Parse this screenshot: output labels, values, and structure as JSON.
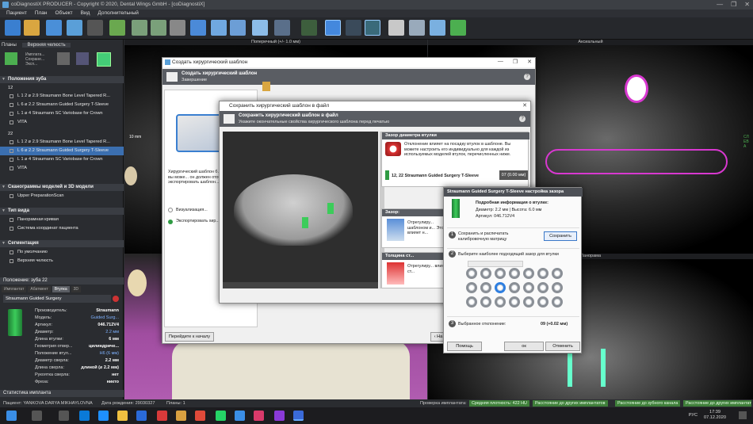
{
  "window": {
    "title": "coDiagnostiX PRODUCER - Copyright © 2020, Dental Wings GmbH - [coDiagnostiX]",
    "controls": [
      "—",
      "❐",
      "✕"
    ]
  },
  "menu": [
    "Пациент",
    "План",
    "Объект",
    "Вид",
    "Дополнительный"
  ],
  "left_panel": {
    "plans_label": "Планы",
    "jaw_label": "Верхняя челюсть",
    "toolbar_texts": [
      "Имплата...",
      "Сохране...",
      "Эксп..."
    ],
    "implants_section": "Положения зуба",
    "group1_label": "12",
    "group1_items": [
      "L 1 2 ⌀ 2.9  Straumann Bone Level Tapered R...",
      "L 6 ⌀ 2.2  Straumann Guided Surgery T-Sleeve",
      "L 1 ⌀ 4  Straumann SC Variobase for Crown",
      "VITA"
    ],
    "group2_label": "22",
    "group2_items": [
      "L 1 2 ⌀ 2.9  Straumann Bone Level Tapered R...",
      "L 6 ⌀ 2.2  Straumann Guided Surgery T-Sleeve",
      "L 1 ⌀ 4  Straumann SC Variobase for Crown",
      "VITA"
    ],
    "models_section": "Сканограммы моделей и 3D модели",
    "models_item": "Upper PreparationScan",
    "view_section": "Тип вида",
    "view_items": [
      "Панорамная кривая",
      "Система координат пациента"
    ],
    "segm_section": "Сегментация",
    "segm_items": [
      "По умолчанию",
      "Верхняя челюсть"
    ],
    "position_label": "Положение: зуба 22",
    "props_tabs": [
      "Имплантат",
      "Абатмент",
      "Втулка",
      "3D"
    ],
    "sleeve_name": "Straumann Guided Surgery",
    "props": [
      {
        "k": "Производитель:",
        "v": "Straumann",
        "blue": false
      },
      {
        "k": "Модель:",
        "v": "Guided Surg...",
        "blue": true
      },
      {
        "k": "Артикул:",
        "v": "046.712V4",
        "blue": false
      },
      {
        "k": "Диаметр:",
        "v": "2.2 мм",
        "blue": true
      },
      {
        "k": "Длина втулки:",
        "v": "6 мм",
        "blue": false
      },
      {
        "k": "Геометрия отвер...",
        "v": "цилиндриче...",
        "blue": false
      },
      {
        "k": "Положение втул...",
        "v": "H6 (6 мм)",
        "blue": true
      },
      {
        "k": "Диаметр сверла:",
        "v": "2.2 мм",
        "blue": false
      },
      {
        "k": "Длина сверла:",
        "v": "длиной (⌀ 2.2 мм)",
        "blue": false
      },
      {
        "k": "Рукоятка сверла:",
        "v": "нет",
        "blue": false
      },
      {
        "k": "Фреза:",
        "v": "никто",
        "blue": false
      }
    ],
    "stats_label": "Статистика импланта"
  },
  "viewports": {
    "cross_label": "Поперечный (+/- 1.0 мм)",
    "axial_label": "Аксиальный",
    "pano_label": "Панорама",
    "scale": "10 mm",
    "right_side_text": "СЛЕВА"
  },
  "dialog_main": {
    "title": "Создать хирургический шаблон",
    "head_title": "Создать хирургический шаблон",
    "head_sub": "Завершение",
    "left_text": "Хирургический шаблон б... создан. Теперь вы може... он должен отображаться... экспортировать шаблон... изготовления.",
    "step1": "Визуализация...",
    "step2": "Экспортировать хир... шаблон...",
    "back_button": "Перейдите к началу"
  },
  "dialog_save": {
    "title": "Сохранить хирургический шаблон в файл",
    "head_title": "Сохранить хирургический шаблон в файл",
    "head_sub": "Укажите окончательные свойства хирургического шаблона перед печатью",
    "gap_title": "Зазор диаметра втулки",
    "gap_text": "Отклонение влияет на посадку втулок в шаблоне. Вы можете настроить его индивидуально для каждой из используемых моделей втулок, перечисленных ниже.",
    "sleeve_row": "12, 22  Straumann Guided Surgery T-Sleeve",
    "sleeve_value": "07 (0.00 мм)",
    "gap2_title": "Зазор:",
    "gap2_text": "Отрегулиру... шаблоном и... Это влияет н...",
    "thick_title": "Толщина ст...",
    "thick_text": "Отрегулиру... влияет на ст..."
  },
  "dialog_gap": {
    "title": "Straumann Guided Surgery T-Sleeve настройка зазора",
    "info_title": "Подробная информация о втулке:",
    "info_dims": "Диаметр: 2.2 мм | Высота: 6.0 мм",
    "info_article": "Артикул: 046.712V4",
    "step1_num": "1",
    "step1_text": "Сохранить и распечатать калибровочную матрицу",
    "save_button": "Сохранить",
    "step2_num": "2",
    "step2_text": "Выберите наиболее подходящий зазор для втулки",
    "step3_num": "3",
    "step3_text": "Выбранное отклонение:",
    "step3_value": "09 (+0.02 мм)",
    "help_button": "Помощь",
    "ok_button": "ок",
    "cancel_button": "Отменить",
    "grid_rows": 3,
    "grid_cols": 7,
    "selected_ring": 9
  },
  "status": {
    "patient": "Пациент: YANKOVA DARYA MIKHAYLOVNA",
    "birth": "Дата рождения: 29030327",
    "plans": "Планы: 1",
    "check": "Проверка имплантата:",
    "badges": [
      "Средняя плотность: 422 HU",
      "Расстояние до других имплантатов",
      "Расстояние до зубного канала",
      "Расстояние до других имплантатов"
    ]
  },
  "taskbar": {
    "time": "17:39",
    "date": "07.12.2020",
    "lang": "РУС"
  },
  "colors": {
    "accent": "#3b6fb0",
    "green": "#3f7f3a",
    "magenta": "#d83fd0"
  }
}
